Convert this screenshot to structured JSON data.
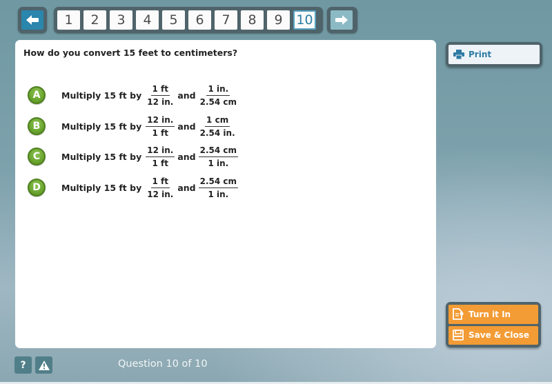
{
  "nav": {
    "prev_icon": "arrow-left-icon",
    "next_icon": "arrow-right-icon",
    "pages": [
      "1",
      "2",
      "3",
      "4",
      "5",
      "6",
      "7",
      "8",
      "9",
      "10"
    ],
    "current_page": "10"
  },
  "question": {
    "text": "How do you convert 15 feet to centimeters?",
    "answers": [
      {
        "letter": "A",
        "prefix": "Multiply 15 ft by",
        "f1_num": "1 ft",
        "f1_den": "12 in.",
        "joiner": "and",
        "f2_num": "1 in.",
        "f2_den": "2.54 cm"
      },
      {
        "letter": "B",
        "prefix": "Multiply 15 ft by",
        "f1_num": "12 in.",
        "f1_den": "1 ft",
        "joiner": "and",
        "f2_num": "1 cm",
        "f2_den": "2.54 in."
      },
      {
        "letter": "C",
        "prefix": "Multiply 15 ft by",
        "f1_num": "12 in.",
        "f1_den": "1 ft",
        "joiner": "and",
        "f2_num": "2.54 cm",
        "f2_den": "1 in."
      },
      {
        "letter": "D",
        "prefix": "Multiply 15 ft by",
        "f1_num": "1 ft",
        "f1_den": "12 in.",
        "joiner": "and",
        "f2_num": "2.54 cm",
        "f2_den": "1 in."
      }
    ]
  },
  "side": {
    "print_label": "Print",
    "print_icon": "printer-icon",
    "turn_in_label": "Turn it In",
    "turn_in_icon": "document-submit-icon",
    "save_close_label": "Save & Close",
    "save_close_icon": "floppy-disk-icon"
  },
  "footer": {
    "help_label": "?",
    "help_icon": "help-icon",
    "report_icon": "warning-icon",
    "status": "Question 10 of 10"
  },
  "colors": {
    "accent_blue": "#2a86ad",
    "answer_green": "#6aa52f",
    "action_orange": "#f39b34",
    "frame_dark": "#4f636a"
  }
}
